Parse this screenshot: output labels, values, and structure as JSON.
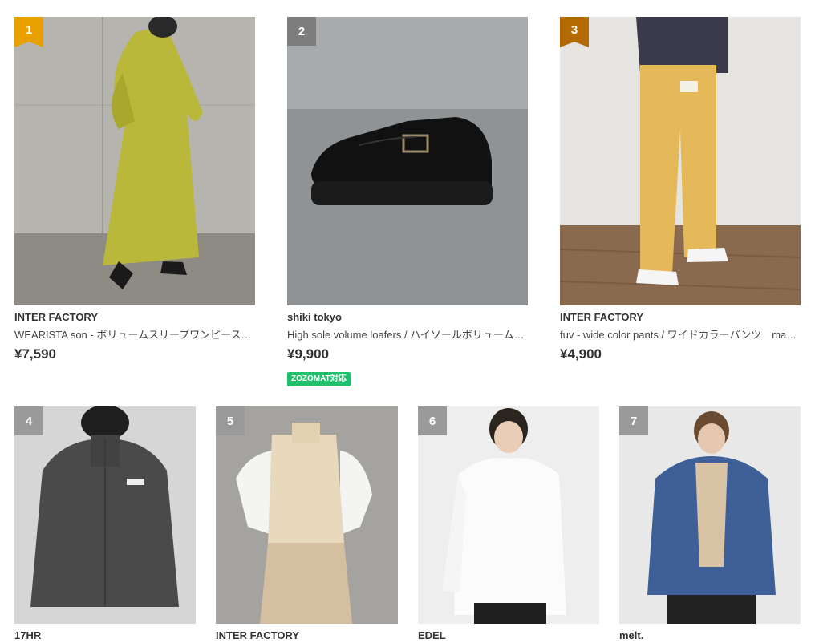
{
  "colors": {
    "rank1": "#e8a000",
    "rank2": "#7d7d7d",
    "rank3": "#b36a00",
    "rank_other": "#9a9a9a",
    "tag_green": "#1fbf6b"
  },
  "items": [
    {
      "rank": "1",
      "brand": "INTER FACTORY",
      "title": "WEARISTA son - ボリュームスリーブワンピース　…",
      "price": "¥7,590"
    },
    {
      "rank": "2",
      "brand": "shiki tokyo",
      "title": "High sole volume loafers / ハイソールボリューム…",
      "price": "¥9,900",
      "tag": "ZOZOMAT対応"
    },
    {
      "rank": "3",
      "brand": "INTER FACTORY",
      "title": "fuv - wide color pants / ワイドカラーパンツ　mad…",
      "price": "¥4,900"
    },
    {
      "rank": "4",
      "brand": "17HR"
    },
    {
      "rank": "5",
      "brand": "INTER FACTORY"
    },
    {
      "rank": "6",
      "brand": "EDEL"
    },
    {
      "rank": "7",
      "brand": "melt."
    }
  ]
}
